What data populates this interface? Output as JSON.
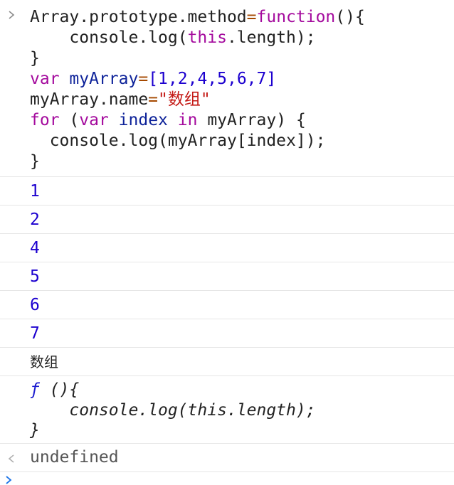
{
  "input": {
    "prompt_icon": "chevron-right-icon",
    "lines": [
      {
        "tokens": [
          {
            "t": "Array.prototype.method",
            "c": "ident"
          },
          {
            "t": "=",
            "c": "op"
          },
          {
            "t": "function",
            "c": "kw"
          },
          {
            "t": "(){",
            "c": "ident"
          }
        ]
      },
      {
        "tokens": [
          {
            "t": "    console.log(",
            "c": "ident"
          },
          {
            "t": "this",
            "c": "kw"
          },
          {
            "t": ".length);",
            "c": "ident"
          }
        ]
      },
      {
        "tokens": [
          {
            "t": "}",
            "c": "ident"
          }
        ]
      },
      {
        "tokens": [
          {
            "t": "var",
            "c": "kw"
          },
          {
            "t": " ",
            "c": "ident"
          },
          {
            "t": "myArray",
            "c": "var"
          },
          {
            "t": "=",
            "c": "op"
          },
          {
            "t": "[1,2,4,5,6,7]",
            "c": "num"
          }
        ]
      },
      {
        "tokens": [
          {
            "t": "myArray.name",
            "c": "ident"
          },
          {
            "t": "=",
            "c": "op"
          },
          {
            "t": "\"数组\"",
            "c": "str"
          }
        ]
      },
      {
        "tokens": [
          {
            "t": "for",
            "c": "kw"
          },
          {
            "t": " (",
            "c": "ident"
          },
          {
            "t": "var",
            "c": "kw"
          },
          {
            "t": " ",
            "c": "ident"
          },
          {
            "t": "index",
            "c": "var"
          },
          {
            "t": " ",
            "c": "ident"
          },
          {
            "t": "in",
            "c": "kw"
          },
          {
            "t": " myArray) {",
            "c": "ident"
          }
        ]
      },
      {
        "tokens": [
          {
            "t": "  console.log(myArray[index]);",
            "c": "ident"
          }
        ]
      },
      {
        "tokens": [
          {
            "t": "}",
            "c": "ident"
          }
        ]
      }
    ]
  },
  "outputs": {
    "numbers": [
      "1",
      "2",
      "4",
      "5",
      "6",
      "7"
    ],
    "name_value": "数组",
    "function_lines": [
      "ƒ (){",
      "    console.log(this.length);",
      "}"
    ]
  },
  "result": {
    "icon": "return-arrow-icon",
    "value": "undefined"
  },
  "colors": {
    "keyword": "#a40a9d",
    "string": "#c41a16",
    "number": "#1c00cf",
    "variable": "#0d2299",
    "operator": "#a54900"
  }
}
